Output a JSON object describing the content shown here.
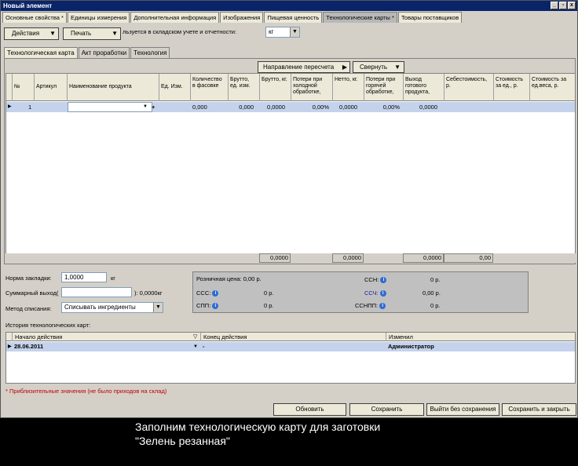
{
  "window": {
    "title": "Новый элемент",
    "min": "_",
    "restore": "▫",
    "close": "x"
  },
  "top_tabs": [
    "Основные свойства *",
    "Единицы измерения",
    "Дополнительная информация",
    "Изображения",
    "Пищевая ценность",
    "Технологические карты *",
    "Товары поставщиков"
  ],
  "toolbar": {
    "actions": "Действия",
    "print": "Печать",
    "print_note": "льзуется в складском учете и отчетности:",
    "unit_value": "кг"
  },
  "inner_tabs": [
    "Технологическая карта",
    "Акт проработки",
    "Технология"
  ],
  "panel_buttons": {
    "recalc": "Направление пересчета",
    "collapse": "Свернуть"
  },
  "grid": {
    "headers": [
      "№",
      "Артикул",
      "Наименование продукта",
      "Ед. Изм.",
      "Количество в фасовке",
      "Брутто, ед. изм.",
      "Брутто, кг.",
      "Потери при холодной обработке,",
      "Нетто, кг.",
      "Потери при горячей обработке,",
      "Выход готового продукта,",
      "Себестоимость, р.",
      "Стоимость за ед., р.",
      "Стоимость за ед.веса, р."
    ],
    "row": [
      "1",
      "",
      "",
      "",
      "0,000",
      "0,000",
      "0,0000",
      "0,00%",
      "0,0000",
      "0,00%",
      "0,0000",
      "",
      "",
      ""
    ],
    "row_add": "+",
    "footer": [
      "0,0000",
      "0,0000",
      "0,0000",
      "0,00"
    ]
  },
  "form": {
    "norm_label": "Норма закладки:",
    "norm_value": "1,0000",
    "norm_unit": "кг",
    "sum_label": "Суммарный выход(",
    "sum_value": "",
    "sum_result": "): 0,0000кг",
    "method_label": "Метод списания:",
    "method_value": "Списывать ингредиенты"
  },
  "info": {
    "retail": "Розничная цена:  0,00 р.",
    "ssn_label": "ССН:",
    "ssn_value": "0 р.",
    "sss_label": "ССС:",
    "sss_value": "0 р.",
    "ssch_label": "ССЧ:",
    "ssch_value": "0,00 р.",
    "spp_label": "СПП:",
    "spp_value": "0 р.",
    "ssnpp_label": "ССНПП:",
    "ssnpp_value": "0 р."
  },
  "history": {
    "label": "История технологических карт:",
    "headers": [
      "Начало действия",
      "Конец действия",
      "Изменил"
    ],
    "row": {
      "start": "28.06.2011",
      "end": "-",
      "user": "Администратор"
    }
  },
  "note": "* Приблизительные значения (не было приходов на склад)",
  "bottom_buttons": [
    "Обновить",
    "Сохранить",
    "Выйти без сохранения",
    "Сохранить и закрыть"
  ],
  "subtitle": [
    "Заполним технологическую карту для заготовки",
    "\"Зелень резанная\""
  ],
  "colors": {
    "title_bar": "#0a246a",
    "selected_row": "#c5d2ec",
    "note": "#c00000"
  }
}
